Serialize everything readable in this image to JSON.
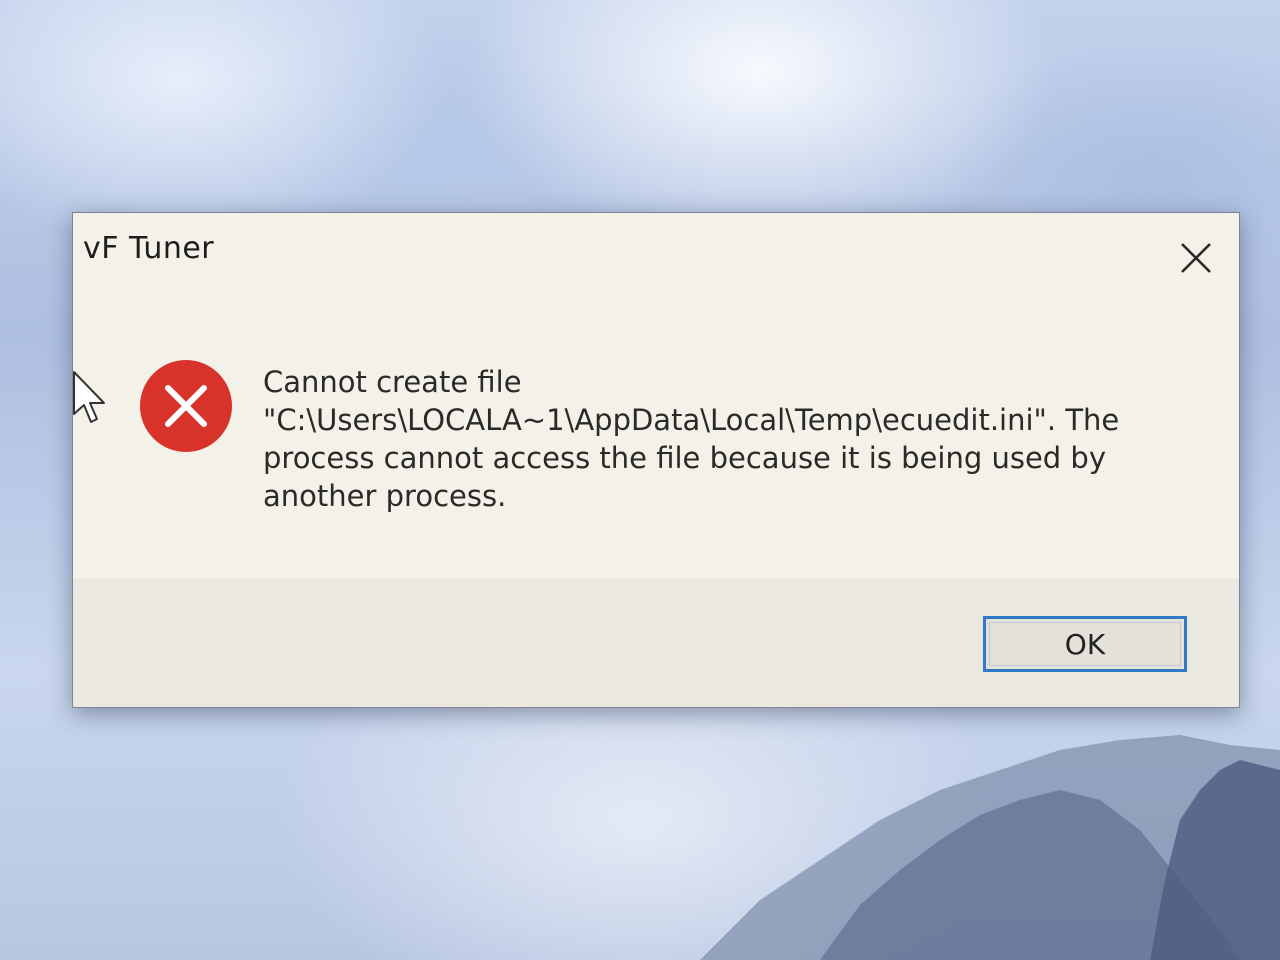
{
  "dialog": {
    "title": "vF Tuner",
    "icon": "error-icon",
    "close_icon": "close-icon",
    "message_lines": [
      "Cannot create file",
      "\"C:\\Users\\LOCALA~1\\AppData\\Local\\Temp\\ecuedit.ini\". The",
      "process cannot access the file because it is being used by",
      "another process."
    ],
    "ok_label": "OK"
  },
  "colors": {
    "error_red": "#d8332b",
    "focus_blue": "#2f7bc9",
    "dialog_bg": "#f4f2e8"
  }
}
